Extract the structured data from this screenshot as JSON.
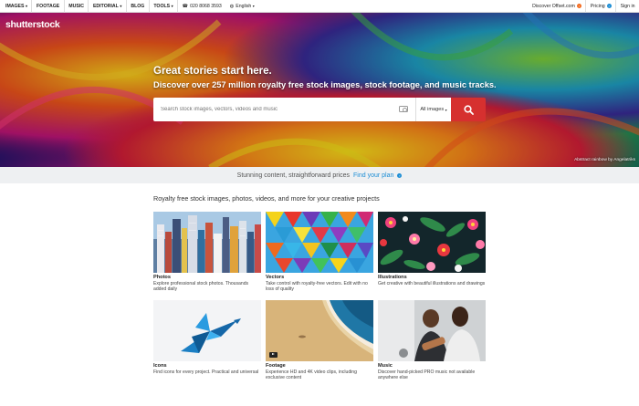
{
  "nav": {
    "items": [
      {
        "label": "IMAGES",
        "caret": true
      },
      {
        "label": "FOOTAGE",
        "caret": false
      },
      {
        "label": "MUSIC",
        "caret": false
      },
      {
        "label": "EDITORIAL",
        "caret": true
      },
      {
        "label": "BLOG",
        "caret": false
      },
      {
        "label": "TOOLS",
        "caret": true
      }
    ],
    "phone": "020 8068 3593",
    "language": "English",
    "offset": "Discover Offset.com",
    "pricing": "Pricing",
    "signin": "Sign in"
  },
  "hero": {
    "logo": "shutterstock",
    "title": "Great stories start here.",
    "subtitle": "Discover over 257 million royalty free stock images, stock footage, and music tracks.",
    "search_placeholder": "Search stock images, vectors, videos and music",
    "search_type": "All images",
    "credit": "Abstract rainbow by Angelatriks"
  },
  "promo": {
    "text": "Stunning content, straightforward prices",
    "link": "Find your plan"
  },
  "section": {
    "title": "Royalty free stock images, photos, videos, and more for your creative projects",
    "cards": [
      {
        "title": "Photos",
        "desc": "Explore professional stock photos. Thousands added daily"
      },
      {
        "title": "Vectors",
        "desc": "Take control with royalty-free vectors. Edit with no loss of quality"
      },
      {
        "title": "Illustrations",
        "desc": "Get creative with beautiful illustrations and drawings"
      },
      {
        "title": "Icons",
        "desc": "Find icons for every project. Practical and universal"
      },
      {
        "title": "Footage",
        "desc": "Experience HD and 4K video clips, including exclusive content"
      },
      {
        "title": "Music",
        "desc": "Discover hand-picked PRO music not available anywhere else"
      }
    ]
  },
  "colors": {
    "accent_red": "#d6302f",
    "link_blue": "#1e8ed5",
    "offset_orange": "#f36c21"
  }
}
